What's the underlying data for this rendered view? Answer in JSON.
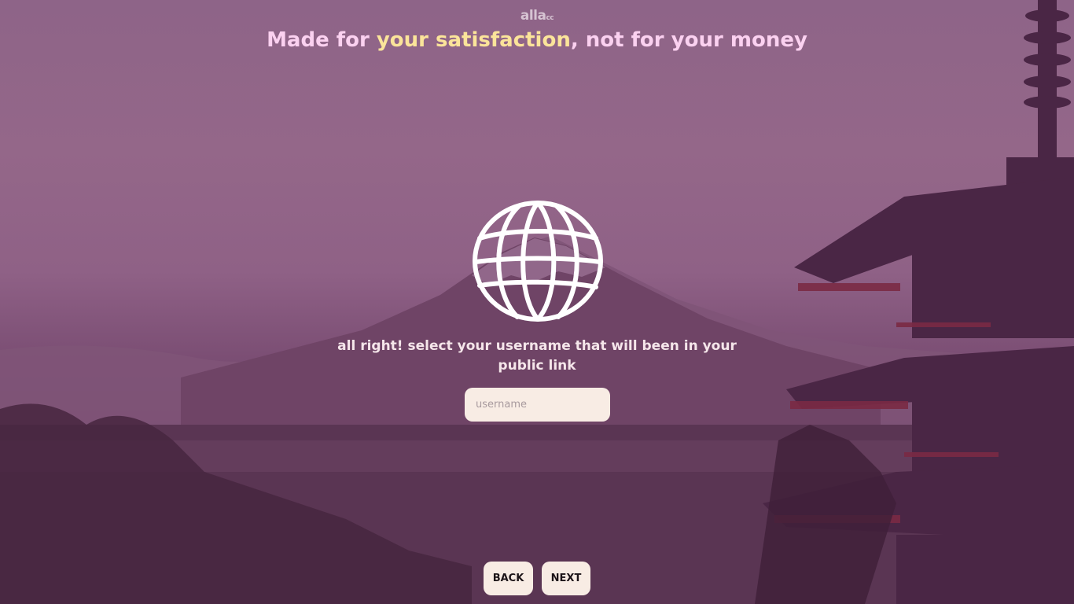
{
  "logo": {
    "main": "alla",
    "sub": "cc"
  },
  "headline": {
    "prefix": "Made for ",
    "highlight": "your satisfaction",
    "suffix": ", not for your money"
  },
  "globe": {
    "icon": "globe-icon"
  },
  "prompt": {
    "text": "all right! select your username that will been in your public link"
  },
  "username": {
    "value": "",
    "placeholder": "username"
  },
  "buttons": {
    "back": "BACK",
    "next": "NEXT"
  },
  "colors": {
    "overlay": "#8e6488",
    "headline": "#fbd1f0",
    "highlight": "#fbe49a",
    "button_bg": "#f8ece4"
  }
}
